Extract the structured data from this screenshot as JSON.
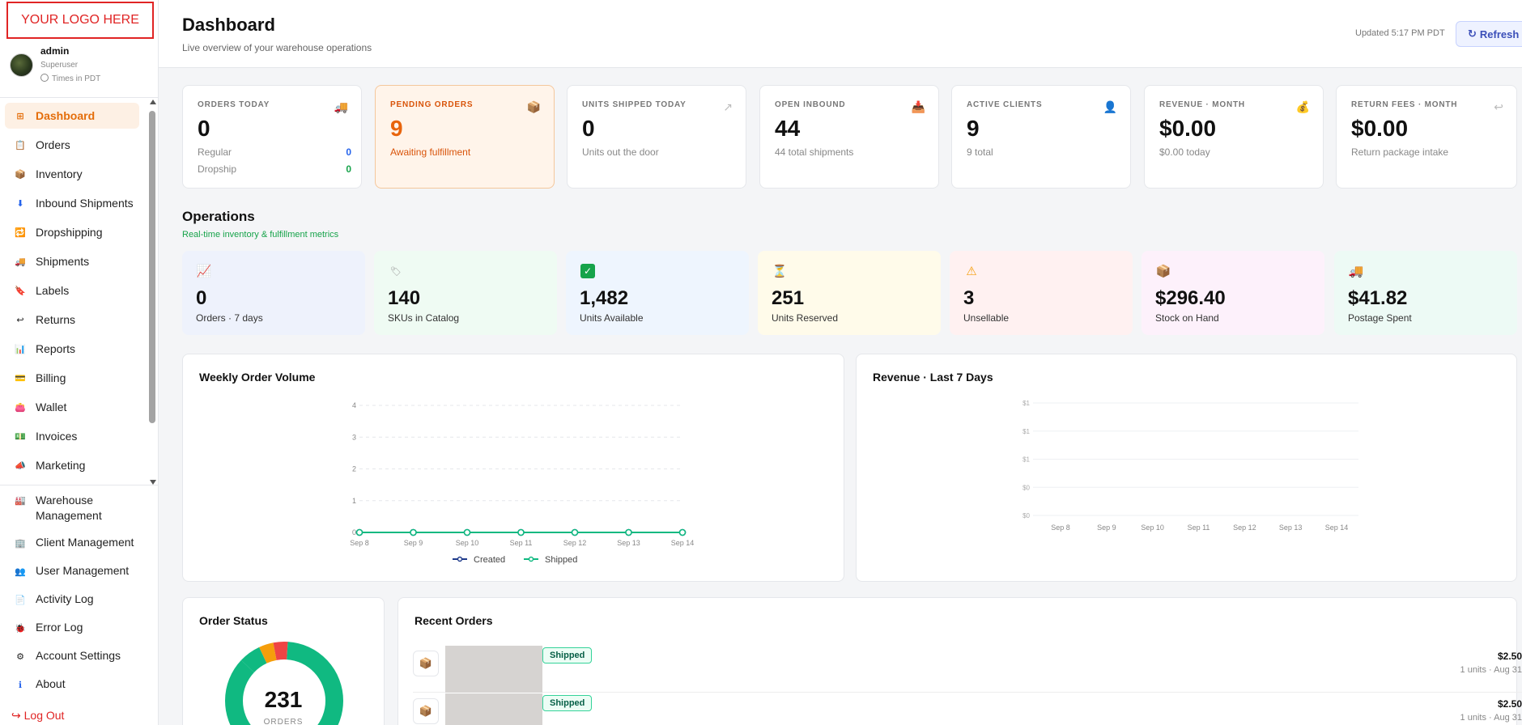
{
  "logo": "YOUR LOGO HERE",
  "user": {
    "name": "admin",
    "role": "Superuser",
    "timezone": "Times in PDT"
  },
  "nav": {
    "items": [
      {
        "label": "Dashboard",
        "icon": "grid-icon",
        "active": true
      },
      {
        "label": "Orders",
        "icon": "clipboard-icon"
      },
      {
        "label": "Inventory",
        "icon": "box-icon"
      },
      {
        "label": "Inbound Shipments",
        "icon": "inbound-icon"
      },
      {
        "label": "Dropshipping",
        "icon": "dropship-icon"
      },
      {
        "label": "Shipments",
        "icon": "truck-icon"
      },
      {
        "label": "Labels",
        "icon": "label-icon"
      },
      {
        "label": "Returns",
        "icon": "return-icon"
      },
      {
        "label": "Reports",
        "icon": "chart-icon"
      },
      {
        "label": "Billing",
        "icon": "card-icon"
      },
      {
        "label": "Wallet",
        "icon": "wallet-icon"
      },
      {
        "label": "Invoices",
        "icon": "invoice-icon"
      },
      {
        "label": "Marketing",
        "icon": "megaphone-icon"
      }
    ],
    "lower": [
      {
        "label": "Warehouse Management",
        "icon": "warehouse-icon"
      },
      {
        "label": "Client Management",
        "icon": "building-icon"
      },
      {
        "label": "User Management",
        "icon": "users-icon"
      },
      {
        "label": "Activity Log",
        "icon": "log-icon"
      },
      {
        "label": "Error Log",
        "icon": "bug-icon"
      },
      {
        "label": "Account Settings",
        "icon": "gear-icon"
      },
      {
        "label": "About",
        "icon": "info-icon"
      }
    ],
    "logout": "Log Out"
  },
  "header": {
    "title": "Dashboard",
    "subtitle": "Live overview of your warehouse operations",
    "updated": "Updated 5:17 PM PDT",
    "refresh": "Refresh"
  },
  "kpis": [
    {
      "label": "ORDERS TODAY",
      "value": "0",
      "rows": [
        {
          "label": "Regular",
          "value": "0",
          "color": "#2563eb"
        },
        {
          "label": "Dropship",
          "value": "0",
          "color": "#16a34a"
        }
      ]
    },
    {
      "label": "PENDING ORDERS",
      "value": "9",
      "sub": "Awaiting fulfillment"
    },
    {
      "label": "UNITS SHIPPED TODAY",
      "value": "0",
      "sub": "Units out the door"
    },
    {
      "label": "OPEN INBOUND",
      "value": "44",
      "sub": "44 total shipments"
    },
    {
      "label": "ACTIVE CLIENTS",
      "value": "9",
      "sub": "9 total"
    },
    {
      "label": "REVENUE · MONTH",
      "value": "$0.00",
      "sub": "$0.00 today"
    },
    {
      "label": "RETURN FEES · MONTH",
      "value": "$0.00",
      "sub": "Return package intake"
    }
  ],
  "operations": {
    "title": "Operations",
    "subtitle": "Real-time inventory & fulfillment metrics",
    "cards": [
      {
        "value": "0",
        "label": "Orders · 7 days",
        "icon": "trend-icon",
        "bg": "#eef2fc"
      },
      {
        "value": "140",
        "label": "SKUs in Catalog",
        "icon": "tag-icon",
        "bg": "#effbf3"
      },
      {
        "value": "1,482",
        "label": "Units Available",
        "icon": "check-icon",
        "bg": "#eef5fe"
      },
      {
        "value": "251",
        "label": "Units Reserved",
        "icon": "hourglass-icon",
        "bg": "#fffbea"
      },
      {
        "value": "3",
        "label": "Unsellable",
        "icon": "warning-icon",
        "bg": "#fff1f1"
      },
      {
        "value": "$296.40",
        "label": "Stock on Hand",
        "icon": "box-icon",
        "bg": "#fdf1fb"
      },
      {
        "value": "$41.82",
        "label": "Postage Spent",
        "icon": "truck-icon",
        "bg": "#edfaf5"
      }
    ]
  },
  "charts": {
    "weekly_title": "Weekly Order Volume",
    "revenue_title": "Revenue · Last 7 Days"
  },
  "chart_data": [
    {
      "type": "line",
      "title": "Weekly Order Volume",
      "categories": [
        "Sep 8",
        "Sep 9",
        "Sep 10",
        "Sep 11",
        "Sep 12",
        "Sep 13",
        "Sep 14"
      ],
      "yticks": [
        "0",
        "1",
        "2",
        "3",
        "4"
      ],
      "ylim": [
        0,
        4
      ],
      "grid": true,
      "legend": "bottom",
      "series": [
        {
          "name": "Created",
          "values": [
            0,
            0,
            0,
            0,
            0,
            0,
            0
          ],
          "color": "#1e3a8a"
        },
        {
          "name": "Shipped",
          "values": [
            0,
            0,
            0,
            0,
            0,
            0,
            0
          ],
          "color": "#10b981"
        }
      ]
    },
    {
      "type": "line",
      "title": "Revenue · Last 7 Days",
      "categories": [
        "Sep 8",
        "Sep 9",
        "Sep 10",
        "Sep 11",
        "Sep 12",
        "Sep 13",
        "Sep 14"
      ],
      "yticks": [
        "$0",
        "$0",
        "$1",
        "$1",
        "$1"
      ],
      "grid": true,
      "series": [
        {
          "values": [
            0,
            0,
            0,
            0,
            0,
            0,
            0
          ]
        }
      ]
    },
    {
      "type": "pie",
      "title": "Order Status",
      "center_value": "231",
      "center_label": "ORDERS",
      "slices": [
        {
          "value": 0.86,
          "color": "#10b981"
        },
        {
          "value": 0.04,
          "color": "#f59e0b"
        },
        {
          "value": 0.04,
          "color": "#ef4444"
        }
      ]
    }
  ],
  "order_status": {
    "title": "Order Status"
  },
  "recent_orders": {
    "title": "Recent Orders",
    "items": [
      {
        "status": "Shipped",
        "amount": "$2.50",
        "meta": "1 units · Aug 31"
      },
      {
        "status": "Shipped",
        "amount": "$2.50",
        "meta": "1 units · Aug 31"
      }
    ]
  }
}
